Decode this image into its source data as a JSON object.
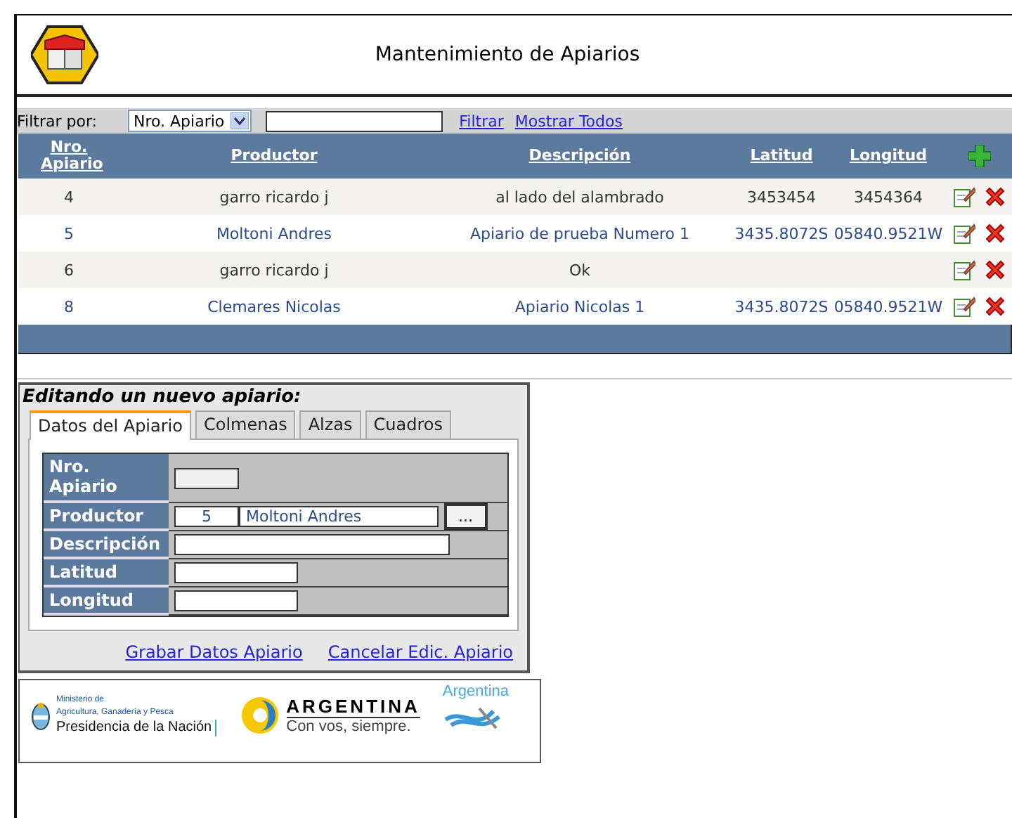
{
  "header": {
    "title": "Mantenimiento de Apiarios"
  },
  "filter": {
    "label": "Filtrar por:",
    "select_value": "Nro. Apiario",
    "links": [
      "Filtrar",
      "Mostrar Todos"
    ]
  },
  "table": {
    "columns": [
      "Nro. Apiario",
      "Productor",
      "Descripción",
      "Latitud",
      "Longitud"
    ],
    "rows": [
      {
        "cells": [
          "4",
          "garro ricardo j",
          "al lado del alambrado",
          "3453454",
          "3454364"
        ]
      },
      {
        "cells": [
          "5",
          "Moltoni Andres",
          "Apiario de prueba Numero 1",
          "3435.8072S",
          "05840.9521W"
        ]
      },
      {
        "cells": [
          "6",
          "garro ricardo j",
          "Ok",
          "",
          ""
        ]
      },
      {
        "cells": [
          "8",
          "Clemares Nicolas",
          "Apiario Nicolas 1",
          "3435.8072S",
          "05840.9521W"
        ]
      }
    ]
  },
  "form": {
    "title": "Editando un nuevo apiario:",
    "tabs": [
      {
        "label": "Datos del Apiario",
        "selected": true
      },
      {
        "label": "Colmenas",
        "selected": false
      },
      {
        "label": "Alzas",
        "selected": false
      },
      {
        "label": "Cuadros",
        "selected": false
      }
    ],
    "fields": [
      {
        "label": "Nro. Apiario",
        "kind": "short",
        "disabled": true
      },
      {
        "label": "Productor",
        "kind": "lookup",
        "code": "5",
        "value": "Moltoni Andres",
        "button": "...",
        "disabled": false
      },
      {
        "label": "Descripción",
        "kind": "long",
        "disabled": false
      },
      {
        "label": "Latitud",
        "kind": "medium",
        "disabled": false
      },
      {
        "label": "Longitud",
        "kind": "medium",
        "disabled": false
      }
    ],
    "links": [
      "Grabar Datos Apiario",
      "Cancelar Edic. Apiario"
    ]
  },
  "footer": {
    "ministry_lines": [
      "Ministerio de",
      "Agricultura, Ganadería y Pesca"
    ],
    "presidency": "Presidencia de la Nación",
    "brand": "ARGENTINA",
    "slogan": "Con vos, siempre.",
    "tourism": "Argentina"
  }
}
